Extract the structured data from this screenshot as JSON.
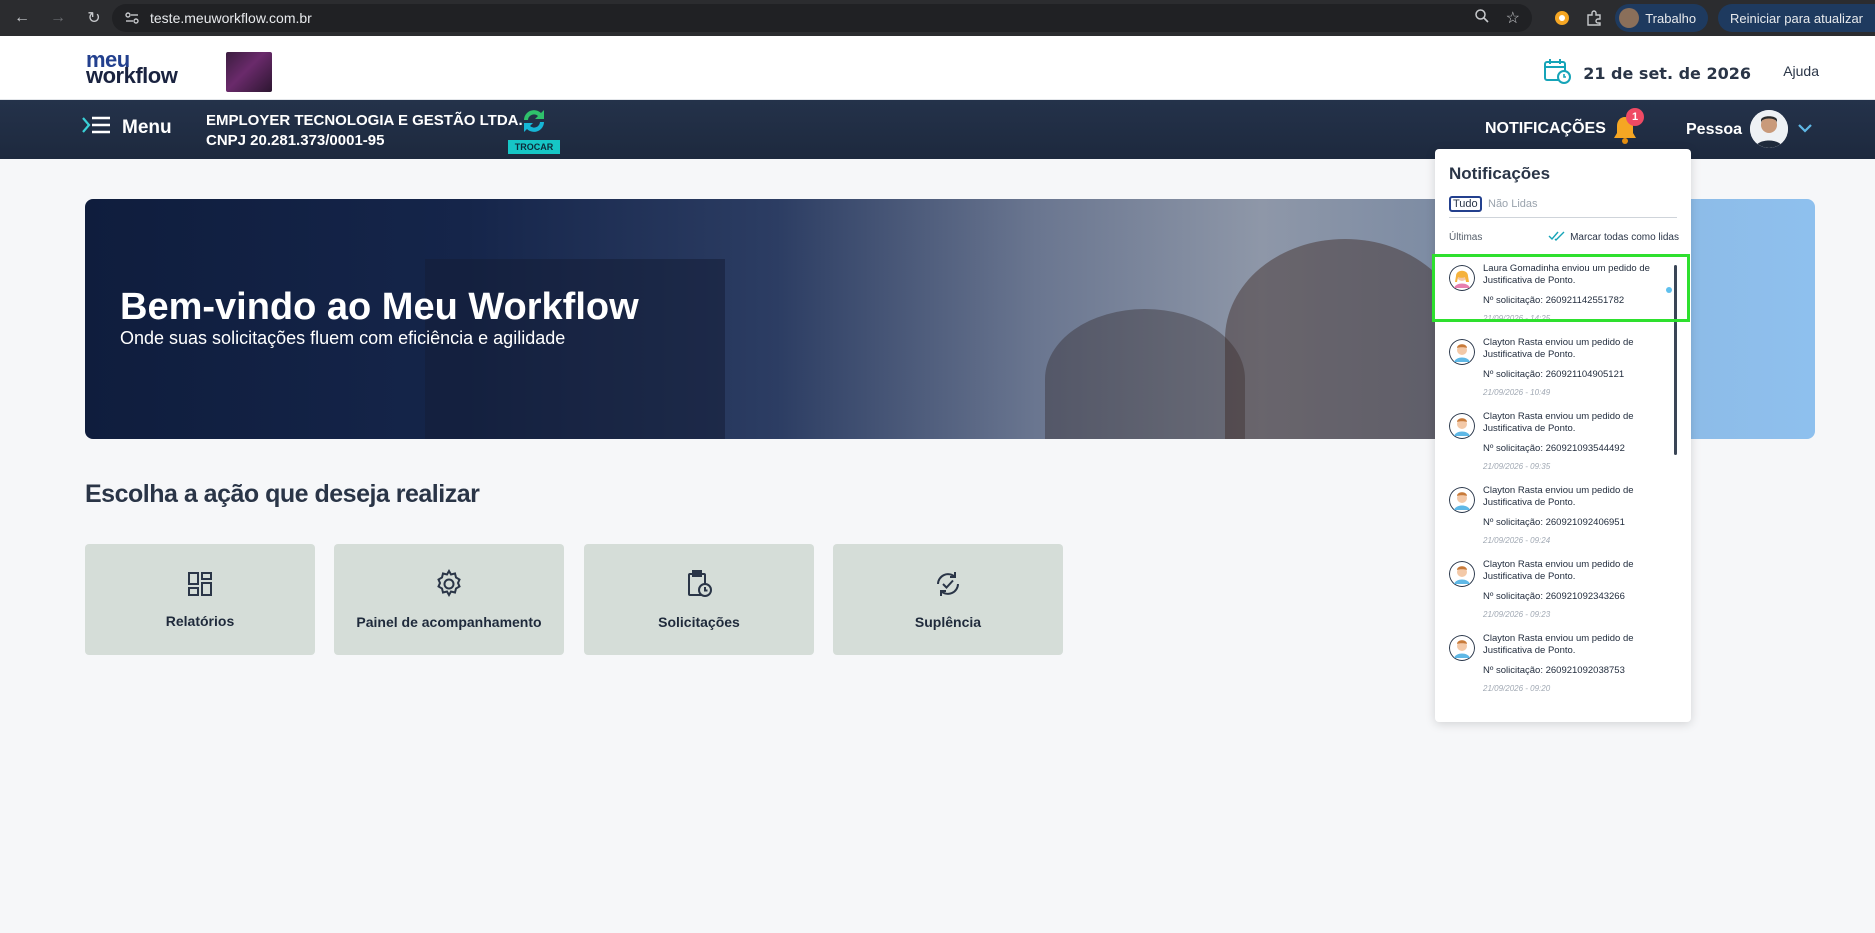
{
  "browser": {
    "url": "teste.meuworkflow.com.br",
    "profile_label": "Trabalho",
    "update_label": "Reiniciar para atualizar"
  },
  "header": {
    "logo_line1": "meu",
    "logo_line2": "workflow",
    "date": "21 de set. de 2026",
    "help": "Ajuda"
  },
  "navbar": {
    "menu_label": "Menu",
    "company_name": "EMPLOYER TECNOLOGIA E GESTÃO LTDA.",
    "company_cnpj": "CNPJ 20.281.373/0001-95",
    "swap_label": "TROCAR",
    "notifications_label": "NOTIFICAÇÕES",
    "notifications_count": "1",
    "user_label": "Pessoa"
  },
  "hero": {
    "title": "Bem-vindo ao Meu Workflow",
    "subtitle": "Onde suas solicitações fluem com eficiência e agilidade"
  },
  "main": {
    "section_title": "Escolha a ação que deseja realizar",
    "cards": [
      {
        "label": "Relatórios",
        "icon": "dashboard-icon"
      },
      {
        "label": "Painel de acompanhamento",
        "icon": "gear-icon"
      },
      {
        "label": "Solicitações",
        "icon": "clipboard-clock-icon"
      },
      {
        "label": "Suplência",
        "icon": "sync-check-icon"
      }
    ]
  },
  "notifications": {
    "title": "Notificações",
    "tab_all": "Tudo",
    "tab_unread": "Não Lidas",
    "subheader": "Últimas",
    "mark_all": "Marcar todas como lidas",
    "items": [
      {
        "message": "Laura Gomadinha enviou um pedido de Justificativa de Ponto.",
        "number": "Nº solicitação: 260921142551782",
        "time": "21/09/2026 - 14:25",
        "unread": true,
        "avatar": "female"
      },
      {
        "message": "Clayton Rasta enviou um pedido de Justificativa de Ponto.",
        "number": "Nº solicitação: 260921104905121",
        "time": "21/09/2026 - 10:49",
        "unread": false,
        "avatar": "male"
      },
      {
        "message": "Clayton Rasta enviou um pedido de Justificativa de Ponto.",
        "number": "Nº solicitação: 260921093544492",
        "time": "21/09/2026 - 09:35",
        "unread": false,
        "avatar": "male"
      },
      {
        "message": "Clayton Rasta enviou um pedido de Justificativa de Ponto.",
        "number": "Nº solicitação: 260921092406951",
        "time": "21/09/2026 - 09:24",
        "unread": false,
        "avatar": "male"
      },
      {
        "message": "Clayton Rasta enviou um pedido de Justificativa de Ponto.",
        "number": "Nº solicitação: 260921092343266",
        "time": "21/09/2026 - 09:23",
        "unread": false,
        "avatar": "male"
      },
      {
        "message": "Clayton Rasta enviou um pedido de Justificativa de Ponto.",
        "number": "Nº solicitação: 260921092038753",
        "time": "21/09/2026 - 09:20",
        "unread": false,
        "avatar": "male"
      }
    ]
  }
}
